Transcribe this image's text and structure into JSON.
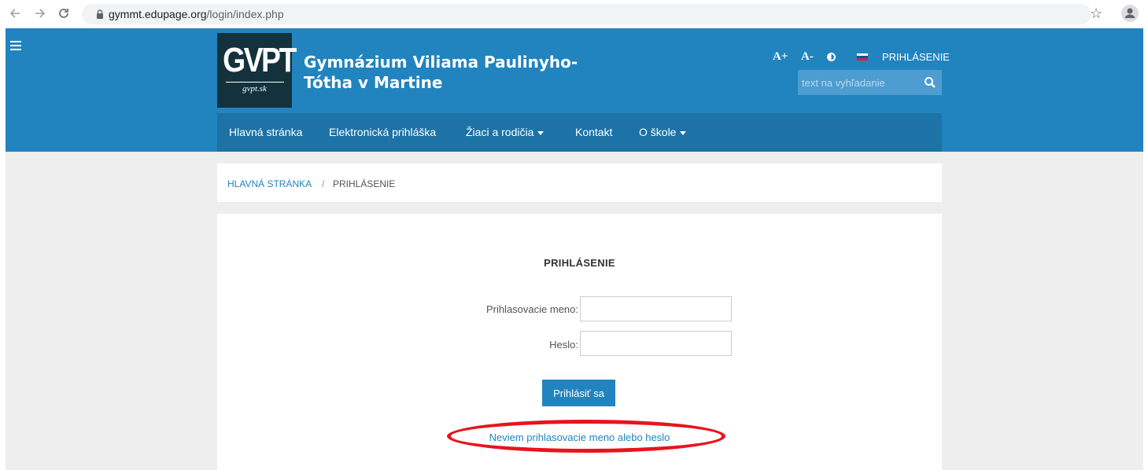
{
  "browser": {
    "back_icon": "arrow-left-icon",
    "forward_icon": "arrow-right-icon",
    "reload_icon": "reload-icon",
    "url_domain": "gymmt.edupage.org",
    "url_path": "/login/index.php",
    "star_icon": "star-icon",
    "profile_icon": "profile-icon"
  },
  "header": {
    "menu_icon": "hamburger-icon",
    "logo_text": "GVPT",
    "logo_subtext": "gvpt.sk",
    "title_line1": "Gymnázium Viliama Paulinyho-",
    "title_line2": "Tótha v Martine",
    "font_increase": "A+",
    "font_decrease": "A-",
    "contrast_icon": "contrast-icon",
    "language_icon": "slovak-flag-icon",
    "login_label": "PRIHLÁSENIE",
    "search_placeholder": "text na vyhľadanie",
    "search_icon": "search-icon",
    "background_color": "#2184bf",
    "nav_color": "#1d72a6"
  },
  "nav": {
    "items": [
      {
        "label": "Hlavná stránka"
      },
      {
        "label": "Elektronická prihláška"
      },
      {
        "label": "Žiaci a rodičia"
      },
      {
        "label": "Kontakt"
      },
      {
        "label": "O škole"
      }
    ]
  },
  "breadcrumb": {
    "home": "HLAVNÁ STRÁNKA",
    "separator": "/",
    "current": "PRIHLÁSENIE"
  },
  "login_form": {
    "title": "PRIHLÁSENIE",
    "username_label": "Prihlasovacie meno:",
    "username_value": "",
    "password_label": "Heslo:",
    "password_value": "",
    "submit_label": "Prihlásiť sa",
    "forgot_link": "Neviem prihlasovacie meno alebo heslo"
  }
}
